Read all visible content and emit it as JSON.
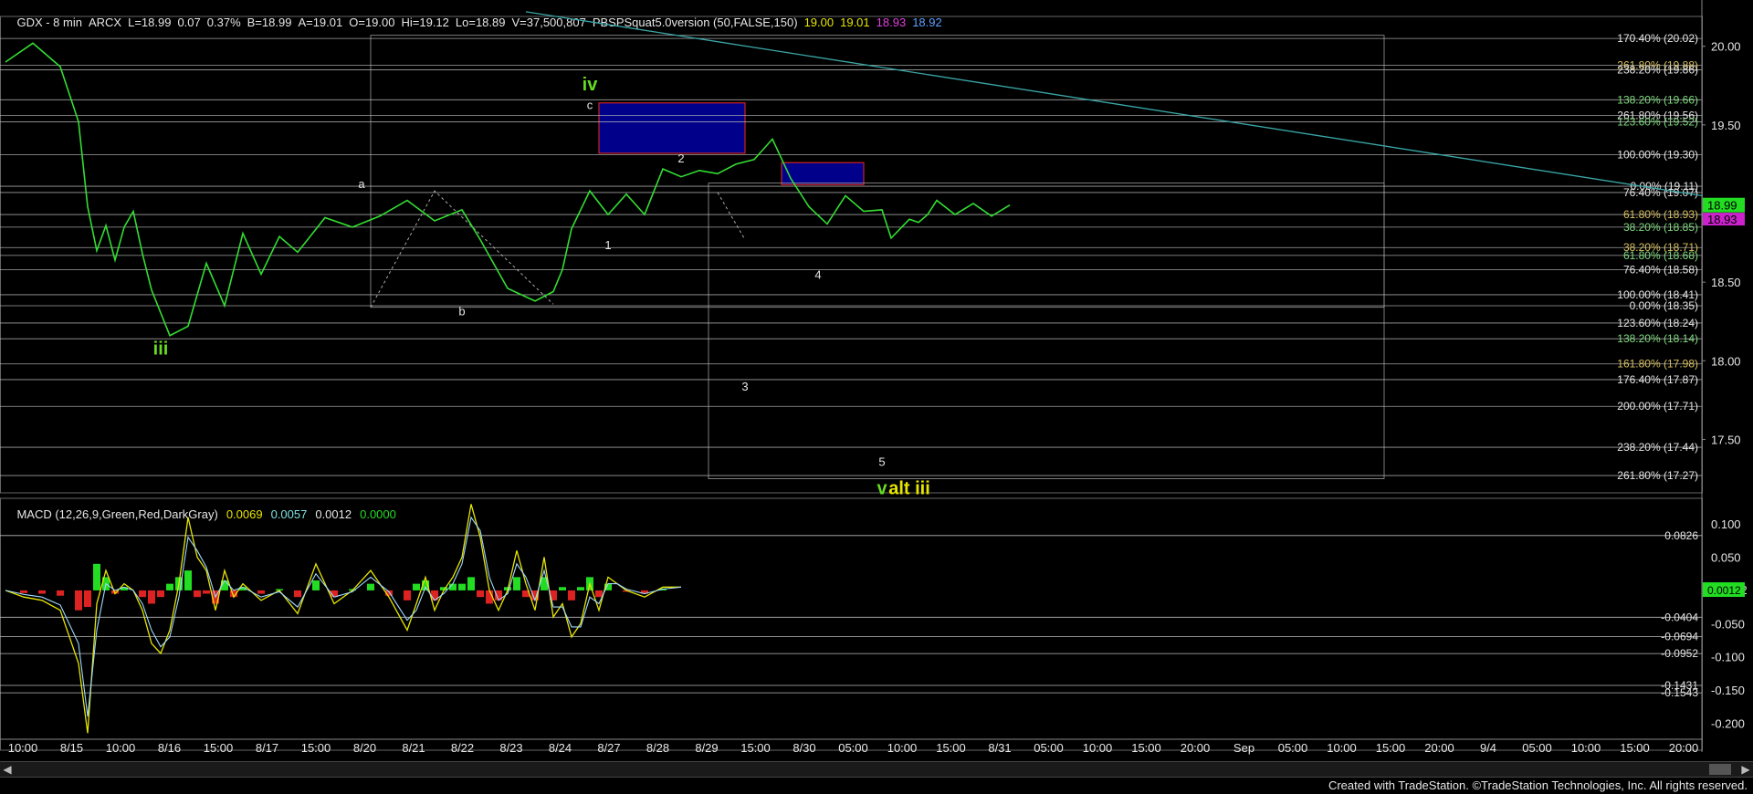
{
  "header": {
    "symbol": "GDX - 8 min",
    "exchange": "ARCX",
    "last": "L=18.99",
    "change": "0.07",
    "pct": "0.37%",
    "bid": "B=18.99",
    "ask": "A=19.01",
    "open": "O=19.00",
    "high": "Hi=19.12",
    "low": "Lo=18.89",
    "volume": "V=37,500,807",
    "indicator": "PBSPSquat5.0version (50,FALSE,150)",
    "ind_values": [
      "19.00",
      "19.01",
      "18.93",
      "18.92"
    ]
  },
  "macd_header": {
    "label": "MACD (12,26,9,Green,Red,DarkGray)",
    "values": [
      "0.0069",
      "0.0057",
      "0.0012",
      "0.0000"
    ]
  },
  "footer": "Created with TradeStation. ©TradeStation Technologies, Inc. All rights reserved.",
  "colors": {
    "price": "#33dd33",
    "wave_label": "#66dd22",
    "alt_label": "#e6e600",
    "fib_line": "#cfcfcf",
    "fib_green": "#7fdc7f",
    "fib_yellow": "#d8c060",
    "fib_white": "#e6e6e6",
    "box_blue": "#00008b",
    "box_border": "#cc2222",
    "trendline": "#3aa6a6",
    "macd_up": "#22dd22",
    "macd_down": "#dd2222",
    "last_tag": "#22dd22",
    "ind_tag": "#cc22cc"
  },
  "chart_data": [
    {
      "type": "line",
      "title": "GDX - 8 min",
      "x_ticks": [
        "10:00",
        "8/15",
        "10:00",
        "8/16",
        "15:00",
        "8/17",
        "15:00",
        "8/20",
        "8/21",
        "8/22",
        "8/23",
        "8/24",
        "8/27",
        "8/28",
        "8/29",
        "15:00",
        "8/30",
        "05:00",
        "10:00",
        "15:00",
        "8/31",
        "05:00",
        "10:00",
        "15:00",
        "20:00",
        "Sep",
        "05:00",
        "10:00",
        "15:00",
        "20:00",
        "9/4",
        "05:00",
        "10:00",
        "15:00",
        "20:00"
      ],
      "y_ticks": [
        "20.00",
        "19.50",
        "19.00",
        "18.50",
        "18.00",
        "17.50"
      ],
      "ylim": [
        17.16,
        20.19
      ],
      "series": [
        {
          "x": [
            0,
            3,
            6,
            8,
            9,
            10,
            11,
            12,
            13,
            14,
            15,
            16,
            18,
            20,
            22,
            24,
            26,
            28,
            30,
            32,
            35,
            38,
            41,
            44,
            47,
            50,
            52,
            55,
            58,
            60,
            61,
            62,
            64,
            66,
            68,
            70,
            72,
            74,
            76,
            78,
            80,
            82,
            84,
            86,
            88,
            90,
            92,
            94,
            96,
            97,
            98,
            99,
            100,
            101,
            102,
            104,
            106,
            108,
            110
          ],
          "y": [
            19.9,
            20.02,
            19.87,
            19.52,
            18.98,
            18.7,
            18.86,
            18.64,
            18.85,
            18.95,
            18.68,
            18.45,
            18.16,
            18.22,
            18.62,
            18.35,
            18.81,
            18.55,
            18.79,
            18.69,
            18.91,
            18.85,
            18.92,
            19.02,
            18.89,
            18.96,
            18.77,
            18.46,
            18.38,
            18.44,
            18.58,
            18.84,
            19.08,
            18.93,
            19.06,
            18.93,
            19.22,
            19.17,
            19.21,
            19.19,
            19.25,
            19.28,
            19.41,
            19.16,
            18.98,
            18.87,
            19.05,
            18.95,
            18.96,
            18.78,
            18.84,
            18.9,
            18.88,
            18.93,
            19.02,
            18.93,
            19.0,
            18.92,
            18.99
          ]
        }
      ],
      "levels": [
        {
          "label": "170.40% (20.02)",
          "value": 20.05,
          "color": "fib_white"
        },
        {
          "label": "261.80% (19.88)",
          "value": 19.88,
          "color": "fib_yellow"
        },
        {
          "label": "238.20% (19.86)",
          "value": 19.85,
          "color": "fib_white"
        },
        {
          "label": "138.20% (19.66)",
          "value": 19.66,
          "color": "fib_green"
        },
        {
          "label": "261.80% (19.56)",
          "value": 19.56,
          "color": "fib_white"
        },
        {
          "label": "123.60% (19.52)",
          "value": 19.52,
          "color": "fib_green"
        },
        {
          "label": "100.00% (19.30)",
          "value": 19.31,
          "color": "fib_white"
        },
        {
          "label": "0.00% (19.11)",
          "value": 19.11,
          "color": "fib_white"
        },
        {
          "label": "76.40% (19.07)",
          "value": 19.07,
          "color": "fib_white"
        },
        {
          "label": "61.80% (18.93)",
          "value": 18.93,
          "color": "fib_yellow"
        },
        {
          "label": "38.20% (18.85)",
          "value": 18.85,
          "color": "fib_green"
        },
        {
          "label": "38.20% (18.71)",
          "value": 18.72,
          "color": "fib_yellow"
        },
        {
          "label": "61.80% (18.68)",
          "value": 18.67,
          "color": "fib_green"
        },
        {
          "label": "76.40% (18.58)",
          "value": 18.58,
          "color": "fib_white"
        },
        {
          "label": "100.00% (18.41)",
          "value": 18.42,
          "color": "fib_white"
        },
        {
          "label": "0.00% (18.35)",
          "value": 18.35,
          "color": "fib_white"
        },
        {
          "label": "123.60% (18.24)",
          "value": 18.24,
          "color": "fib_white"
        },
        {
          "label": "138.20% (18.14)",
          "value": 18.14,
          "color": "fib_green"
        },
        {
          "label": "161.80% (17.98)",
          "value": 17.98,
          "color": "fib_yellow"
        },
        {
          "label": "176.40% (17.87)",
          "value": 17.88,
          "color": "fib_white"
        },
        {
          "label": "200.00% (17.71)",
          "value": 17.71,
          "color": "fib_white"
        },
        {
          "label": "238.20% (17.44)",
          "value": 17.45,
          "color": "fib_white"
        },
        {
          "label": "261.80% (17.27)",
          "value": 17.27,
          "color": "fib_white"
        }
      ],
      "wave_labels": [
        {
          "text": "iii",
          "x": 17,
          "y": 18.04,
          "color": "wave_label",
          "bold": true
        },
        {
          "text": "a",
          "x": 39,
          "y": 19.1,
          "color": "fib_white"
        },
        {
          "text": "b",
          "x": 50,
          "y": 18.29,
          "color": "fib_white"
        },
        {
          "text": "iv",
          "x": 64,
          "y": 19.72,
          "color": "wave_label",
          "bold": true
        },
        {
          "text": "c",
          "x": 64,
          "y": 19.6,
          "color": "fib_white"
        },
        {
          "text": "1",
          "x": 66,
          "y": 18.71,
          "color": "fib_white"
        },
        {
          "text": "2",
          "x": 74,
          "y": 19.26,
          "color": "fib_white"
        },
        {
          "text": "4",
          "x": 89,
          "y": 18.52,
          "color": "fib_white"
        },
        {
          "text": "3",
          "x": 81,
          "y": 17.81,
          "color": "fib_white"
        },
        {
          "text": "5",
          "x": 96,
          "y": 17.33,
          "color": "fib_white"
        },
        {
          "text": "v",
          "x": 96,
          "y": 17.15,
          "color": "wave_label",
          "bold": true
        },
        {
          "text": "alt iii",
          "x": 99,
          "y": 17.15,
          "color": "alt_label",
          "bold": true
        }
      ],
      "last_value": "18.99",
      "indicator_value": "18.93"
    },
    {
      "type": "area",
      "title": "MACD (12,26,9,Green,Red,DarkGray)",
      "y_ticks": [
        "0.100",
        "0.050",
        "0.0012",
        "-0.050",
        "-0.100",
        "-0.150",
        "-0.200"
      ],
      "ylim": [
        -0.227,
        0.125
      ],
      "levels": [
        {
          "label": "0.0826",
          "value": 0.0826
        },
        {
          "label": "-0.0404",
          "value": -0.0404
        },
        {
          "label": "-0.0694",
          "value": -0.0694
        },
        {
          "label": "-0.0952",
          "value": -0.0952
        },
        {
          "label": "-0.1431",
          "value": -0.1431
        },
        {
          "label": "-0.1543",
          "value": -0.1543
        }
      ],
      "x": [
        0,
        2,
        4,
        6,
        8,
        9,
        10,
        11,
        12,
        13,
        14,
        15,
        16,
        17,
        18,
        19,
        20,
        21,
        22,
        23,
        24,
        25,
        26,
        28,
        30,
        32,
        34,
        36,
        38,
        40,
        42,
        44,
        45,
        46,
        47,
        48,
        49,
        50,
        51,
        52,
        53,
        54,
        55,
        56,
        57,
        58,
        59,
        60,
        61,
        62,
        63,
        64,
        65,
        66,
        67,
        68,
        70,
        72,
        74
      ],
      "macd": [
        0.0,
        -0.01,
        -0.015,
        -0.03,
        -0.11,
        -0.215,
        -0.02,
        0.03,
        -0.005,
        0.01,
        0.0,
        -0.03,
        -0.08,
        -0.095,
        -0.06,
        0.01,
        0.11,
        0.05,
        0.03,
        -0.03,
        0.03,
        -0.01,
        0.01,
        -0.015,
        0.0,
        -0.035,
        0.04,
        -0.02,
        0.0,
        0.03,
        -0.01,
        -0.06,
        -0.02,
        0.02,
        -0.03,
        0.0,
        0.02,
        0.05,
        0.13,
        0.08,
        0.0,
        -0.03,
        0.0,
        0.06,
        0.01,
        -0.03,
        0.05,
        -0.04,
        -0.02,
        -0.07,
        -0.05,
        0.01,
        -0.03,
        0.02,
        0.01,
        0.0,
        -0.01,
        0.005,
        0.005
      ],
      "signal": [
        0.0,
        -0.006,
        -0.01,
        -0.022,
        -0.08,
        -0.19,
        -0.06,
        0.01,
        0.0,
        0.005,
        0.0,
        -0.02,
        -0.06,
        -0.085,
        -0.07,
        -0.01,
        0.08,
        0.06,
        0.035,
        -0.01,
        0.015,
        0.0,
        0.005,
        -0.01,
        -0.002,
        -0.025,
        0.025,
        -0.01,
        -0.002,
        0.02,
        -0.002,
        -0.045,
        -0.03,
        0.005,
        -0.015,
        -0.005,
        0.01,
        0.04,
        0.11,
        0.09,
        0.02,
        -0.015,
        -0.005,
        0.04,
        0.02,
        -0.015,
        0.03,
        -0.025,
        -0.025,
        -0.055,
        -0.055,
        -0.01,
        -0.02,
        0.01,
        0.01,
        0.002,
        -0.005,
        0.002,
        0.005
      ]
    }
  ]
}
